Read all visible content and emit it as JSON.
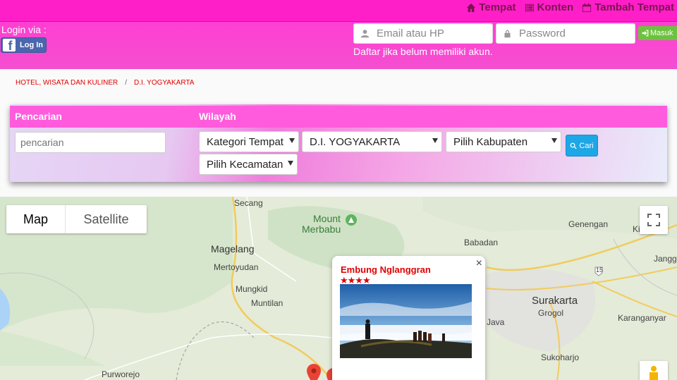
{
  "topnav": {
    "items": [
      {
        "label": "Tempat",
        "icon": "home-icon"
      },
      {
        "label": "Konten",
        "icon": "list-icon"
      },
      {
        "label": "Tambah Tempat",
        "icon": "calendar-icon"
      }
    ]
  },
  "login": {
    "via_label": "Login via :",
    "facebook_button": "Log In",
    "email_placeholder": "Email atau HP",
    "password_placeholder": "Password",
    "submit_label": "Masuk",
    "register_text": "Daftar jika belum memiliki akun."
  },
  "breadcrumb": [
    "HOTEL, WISATA DAN KULINER",
    "D.I. YOGYAKARTA"
  ],
  "search": {
    "heading_search": "Pencarian",
    "heading_region": "Wilayah",
    "search_placeholder": "pencarian",
    "category_select": "Kategori Tempat",
    "province_select": "D.I. YOGYAKARTA",
    "regency_select": "Pilih Kabupaten",
    "district_select": "Pilih Kecamatan",
    "button_label": "Cari"
  },
  "map": {
    "type_map": "Map",
    "type_satellite": "Satellite",
    "labels": {
      "secang": "Secang",
      "mount": "Mount",
      "merbabu": "Merbabu",
      "magelang": "Magelang",
      "mertoyudan": "Mertoyudan",
      "mungkid": "Mungkid",
      "muntilan": "Muntilan",
      "purworejo": "Purworejo",
      "babadan": "Babadan",
      "genengan": "Genengan",
      "ki": "Ki",
      "jangg": "Jangg",
      "surakarta": "Surakarta",
      "grogol": "Grogol",
      "karanganyar": "Karanganyar",
      "java": "Java",
      "sukoharjo": "Sukoharjo",
      "route15": "15"
    },
    "infowindow": {
      "title": "Embung Nglanggran",
      "stars": "★★★★",
      "close": "×"
    }
  },
  "colors": {
    "topnav": "#ff1fc8",
    "accent": "#ff5bdc",
    "link_red": "#e00000",
    "button_blue": "#1da7e6",
    "button_green": "#6cc23e"
  }
}
